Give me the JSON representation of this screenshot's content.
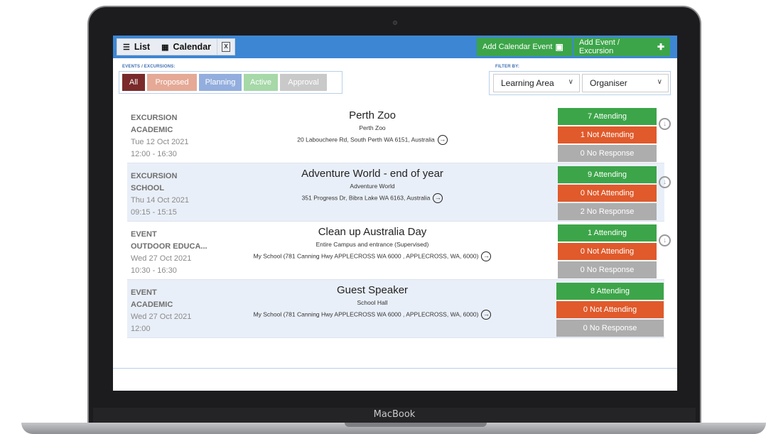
{
  "device": {
    "brand": "MacBook"
  },
  "toolbar": {
    "list_label": "List",
    "calendar_label": "Calendar",
    "export_label": "X",
    "add_calendar_event": "Add Calendar Event",
    "add_event_excursion": "Add Event / Excursion",
    "add_calendar_icon": "calendar-plus-icon",
    "add_event_icon": "plus-icon"
  },
  "filters": {
    "types_label": "EVENTS / EXCURSIONS:",
    "filter_label": "FILTER BY:",
    "chips": [
      {
        "label": "All",
        "color": "#7a2a2a"
      },
      {
        "label": "Proposed",
        "color": "#e5a996"
      },
      {
        "label": "Planning",
        "color": "#93aede"
      },
      {
        "label": "Active",
        "color": "#a6d8a8"
      },
      {
        "label": "Approval",
        "color": "#c9c9c9"
      }
    ],
    "learning_area": "Learning Area",
    "organiser": "Organiser"
  },
  "events": [
    {
      "type": "EXCURSION",
      "category": "ACADEMIC",
      "date": "Tue 12 Oct 2021",
      "time": "12:00 - 16:30",
      "title": "Perth Zoo",
      "location": "Perth Zoo",
      "address": "20 Labouchere Rd, South Perth WA 6151, Australia",
      "attending": "7 Attending",
      "not_attending": "1 Not Attending",
      "no_response": "0 No Response"
    },
    {
      "type": "EXCURSION",
      "category": "SCHOOL",
      "date": "Thu 14 Oct 2021",
      "time": "09:15 - 15:15",
      "title": "Adventure World - end of year",
      "location": "Adventure World",
      "address": "351 Progress Dr, Bibra Lake WA 6163, Australia",
      "attending": "9 Attending",
      "not_attending": "0 Not Attending",
      "no_response": "2 No Response"
    },
    {
      "type": "EVENT",
      "category": "OUTDOOR EDUCA...",
      "date": "Wed 27 Oct 2021",
      "time": "10:30 - 16:30",
      "title": "Clean up Australia Day",
      "location": "Entire Campus and entrance (Supervised)",
      "address": "My School (781 Canning Hwy APPLECROSS WA 6000 , APPLECROSS, WA, 6000)",
      "attending": "1 Attending",
      "not_attending": "0 Not Attending",
      "no_response": "0 No Response"
    },
    {
      "type": "EVENT",
      "category": "ACADEMIC",
      "date": "Wed 27 Oct 2021",
      "time": "12:00",
      "title": "Guest Speaker",
      "location": "School Hall",
      "address": "My School (781 Canning Hwy APPLECROSS WA 6000 , APPLECROSS, WA, 6000)",
      "attending": "8 Attending",
      "not_attending": "0 Not Attending",
      "no_response": "0 No Response"
    }
  ]
}
